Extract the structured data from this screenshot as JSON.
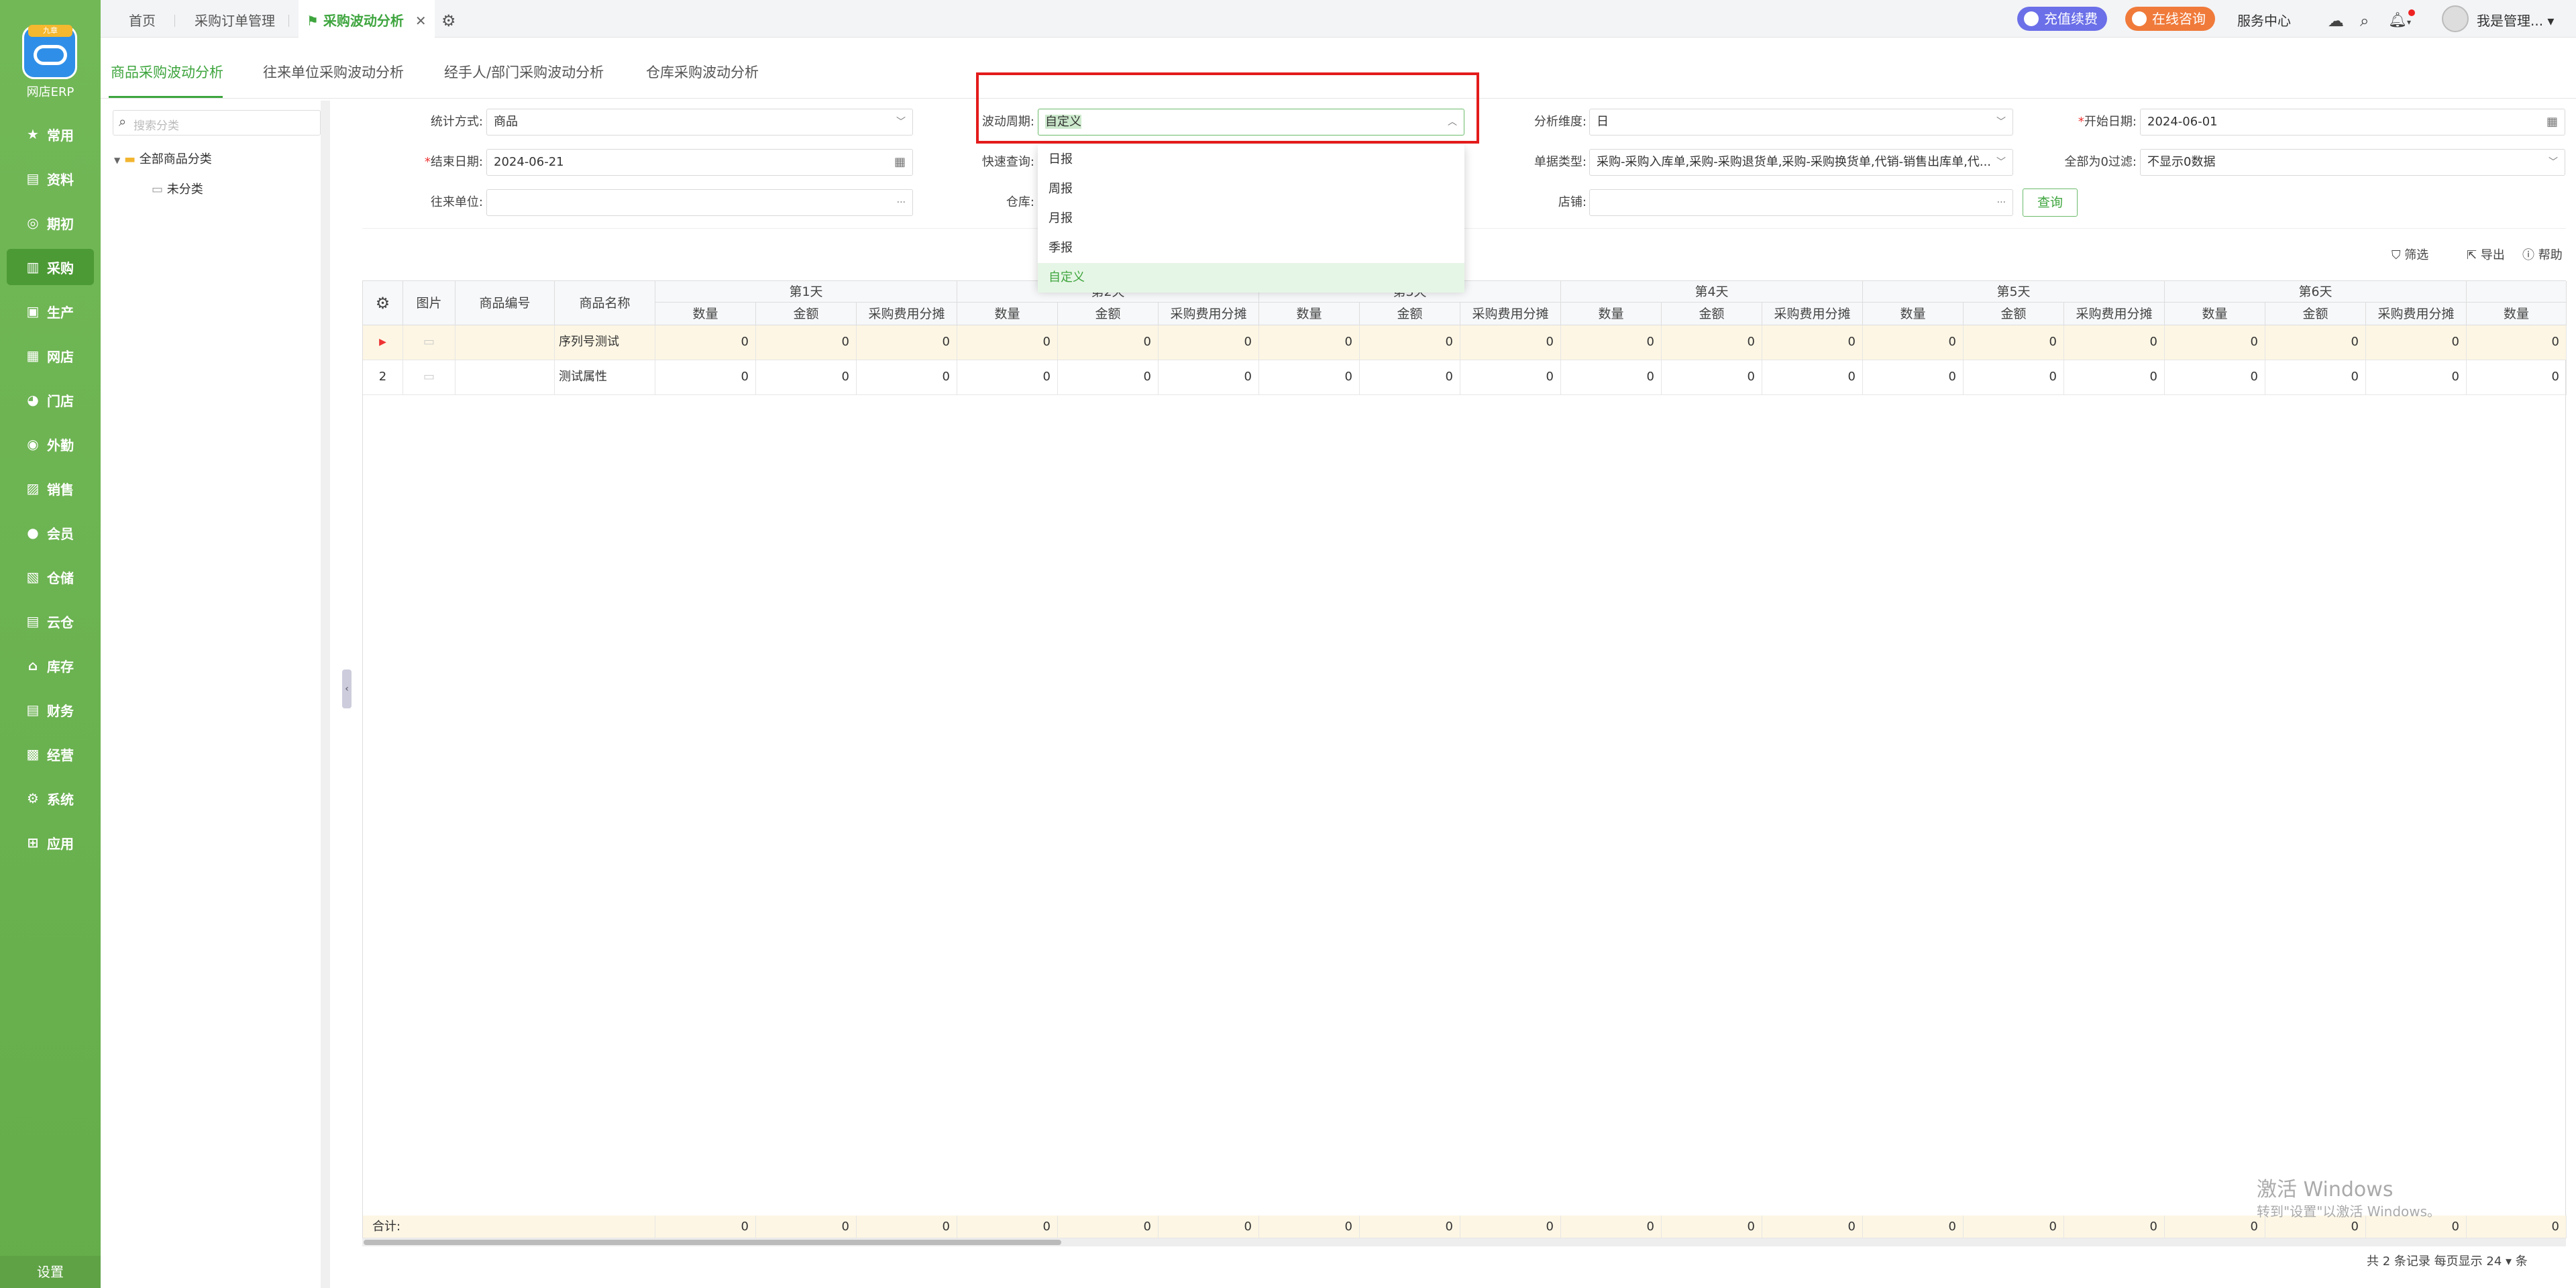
{
  "app": {
    "logo_ribbon": "九章",
    "logo_name": "网店ERP"
  },
  "sidebar": {
    "items": [
      {
        "label": "常用",
        "icon": "star-icon",
        "glyph": "★"
      },
      {
        "label": "资料",
        "icon": "doc-icon",
        "glyph": "▤"
      },
      {
        "label": "期初",
        "icon": "target-icon",
        "glyph": "◎"
      },
      {
        "label": "采购",
        "icon": "purchase-icon",
        "glyph": "▥"
      },
      {
        "label": "生产",
        "icon": "produce-icon",
        "glyph": "▣"
      },
      {
        "label": "网店",
        "icon": "shop-icon",
        "glyph": "▦"
      },
      {
        "label": "门店",
        "icon": "pie-icon",
        "glyph": "◕"
      },
      {
        "label": "外勤",
        "icon": "field-icon",
        "glyph": "◉"
      },
      {
        "label": "销售",
        "icon": "sales-icon",
        "glyph": "▨"
      },
      {
        "label": "会员",
        "icon": "member-icon",
        "glyph": "●"
      },
      {
        "label": "仓储",
        "icon": "storage-icon",
        "glyph": "▧"
      },
      {
        "label": "云仓",
        "icon": "cloud-icon",
        "glyph": "▤"
      },
      {
        "label": "库存",
        "icon": "stock-icon",
        "glyph": "⌂"
      },
      {
        "label": "财务",
        "icon": "finance-icon",
        "glyph": "▤"
      },
      {
        "label": "经营",
        "icon": "business-icon",
        "glyph": "▩"
      },
      {
        "label": "系统",
        "icon": "system-icon",
        "glyph": "⚙"
      },
      {
        "label": "应用",
        "icon": "app-icon",
        "glyph": "⊞"
      }
    ],
    "active_index": 3,
    "settings": "设置"
  },
  "topbar": {
    "tabs": [
      "首页",
      "采购订单管理",
      "采购波动分析"
    ],
    "recharge": "充值续费",
    "consult": "在线咨询",
    "service": "服务中心",
    "user": "我是管理..."
  },
  "subtabs": [
    "商品采购波动分析",
    "往来单位采购波动分析",
    "经手人/部门采购波动分析",
    "仓库采购波动分析"
  ],
  "tree": {
    "search_placeholder": "搜索分类",
    "root": "全部商品分类",
    "child": "未分类"
  },
  "filters": {
    "stat_label": "统计方式:",
    "stat_value": "商品",
    "period_label": "波动周期:",
    "period_value": "自定义",
    "dim_label": "分析维度:",
    "dim_value": "日",
    "start_label": "开始日期:",
    "start_value": "2024-06-01",
    "end_label": "结束日期:",
    "end_value": "2024-06-21",
    "quick_label": "快速查询:",
    "doctype_label": "单据类型:",
    "doctype_value": "采购-采购入库单,采购-采购退货单,采购-采购换货单,代销-销售出库单,代...",
    "zero_label": "全部为0过滤:",
    "zero_value": "不显示0数据",
    "partner_label": "往来单位:",
    "warehouse_label": "仓库:",
    "store_label": "店铺:",
    "query": "查询"
  },
  "dropdown": {
    "options": [
      "日报",
      "周报",
      "月报",
      "季报",
      "自定义"
    ],
    "selected": 4
  },
  "tools": {
    "filter": "筛选",
    "export": "导出",
    "help": "帮助"
  },
  "grid": {
    "fixed_headers": [
      "图片",
      "商品编号",
      "商品名称"
    ],
    "groups": [
      "第1天",
      "第2天",
      "第3天",
      "第4天",
      "第5天",
      "第6天"
    ],
    "sub_headers": [
      "数量",
      "金额",
      "采购费用分摊"
    ],
    "rows": [
      {
        "index": "",
        "name": "序列号测试"
      },
      {
        "index": "2",
        "name": "测试属性"
      }
    ],
    "zero": "0",
    "total_label": "合计:"
  },
  "footer": {
    "summary": "共 2 条记录",
    "per_page_label": "每页显示",
    "per_page": "24",
    "unit": "条"
  },
  "watermark": {
    "title": "激活 Windows",
    "sub": "转到\"设置\"以激活 Windows。"
  }
}
